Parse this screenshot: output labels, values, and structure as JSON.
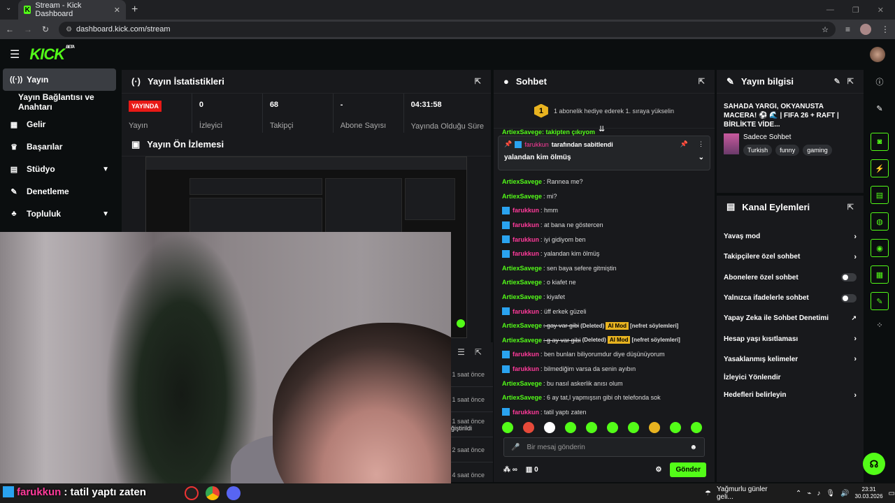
{
  "browser": {
    "tab_title": "Stream - Kick Dashboard",
    "tab_favicon": "K",
    "url": "dashboard.kick.com/stream"
  },
  "header": {
    "logo": "KICK",
    "beta": "BETA"
  },
  "sidebar": {
    "items": [
      {
        "label": "Yayın",
        "icon": "broadcast-icon"
      },
      {
        "label": "Yayın Bağlantısı ve Anahtarı"
      },
      {
        "label": "Gelir",
        "icon": "revenue-icon"
      },
      {
        "label": "Başarılar",
        "icon": "trophy-icon"
      },
      {
        "label": "Stüdyo",
        "icon": "studio-icon"
      },
      {
        "label": "Denetleme",
        "icon": "wrench-icon"
      },
      {
        "label": "Topluluk",
        "icon": "community-icon"
      }
    ]
  },
  "stats": {
    "title": "Yayın İstatistikleri",
    "live_badge": "YAYINDA",
    "items": [
      {
        "value": "",
        "label": "Yayın"
      },
      {
        "value": "0",
        "label": "İzleyici"
      },
      {
        "value": "68",
        "label": "Takipçi"
      },
      {
        "value": "-",
        "label": "Abone Sayısı"
      },
      {
        "value": "04:31:58",
        "label": "Yayında Olduğu Süre"
      }
    ]
  },
  "preview": {
    "title": "Yayın Ön İzlemesi"
  },
  "history": {
    "times": [
      "1 saat önce",
      "1 saat önce",
      "1 saat önce",
      "2 saat önce",
      "4 saat önce"
    ],
    "changed": "ğiştirildi"
  },
  "overlay": {
    "name": "farukkun",
    "text": ": tatil yaptı zaten"
  },
  "chat": {
    "title": "Sohbet",
    "gift_badge": "1",
    "gift_text": "1 abonelik hediye ederek 1. sıraya yükselin",
    "partial_top": "ArtiexSavege: takipten çıkıyom",
    "pinned_by": "farukkun",
    "pinned_suffix": " tarafından sabitlendi",
    "pinned_msg": "yalandan kim ölmüş",
    "messages": [
      {
        "user": "ArtiexSavege",
        "color": "green",
        "text": ": Rannea me?"
      },
      {
        "user": "ArtiexSavege",
        "color": "green",
        "text": ": mi?"
      },
      {
        "user": "farukkun",
        "color": "pink",
        "text": ": hmm"
      },
      {
        "user": "farukkun",
        "color": "pink",
        "text": ": at bana ne göstercen"
      },
      {
        "user": "farukkun",
        "color": "pink",
        "text": ": iyi gidiyom ben"
      },
      {
        "user": "farukkun",
        "color": "pink",
        "text": ": yalandan kim ölmüş"
      },
      {
        "user": "ArtiexSavege",
        "color": "green",
        "text": ": sen baya sefere gitmiştin"
      },
      {
        "user": "ArtiexSavege",
        "color": "green",
        "text": ": o kiafet ne"
      },
      {
        "user": "ArtiexSavege",
        "color": "green",
        "text": ": kiyafet"
      },
      {
        "user": "farukkun",
        "color": "pink",
        "text": ": üff erkek güzeli"
      },
      {
        "user": "ArtiexSavege",
        "color": "green",
        "text": ": gay var gibi",
        "deleted": "(Deleted)",
        "tag": "AI Mod",
        "reason": "[nefret söylemleri]"
      },
      {
        "user": "ArtiexSavege",
        "color": "green",
        "text": ": g ay var gibi",
        "deleted": "(Deleted)",
        "tag": "AI Mod",
        "reason": "[nefret söylemleri]"
      },
      {
        "user": "farukkun",
        "color": "pink",
        "text": ": ben bunları biliyorumdur diye düşünüyorum"
      },
      {
        "user": "farukkun",
        "color": "pink",
        "text": ": bilmediğim varsa da senin ayıbın"
      },
      {
        "user": "ArtiexSavege",
        "color": "green",
        "text": ": bu nasıl askerlik anısı olum"
      },
      {
        "user": "ArtiexSavege",
        "color": "green",
        "text": ": 6 ay tat,l yapmışsın gibi oh telefonda sok"
      },
      {
        "user": "farukkun",
        "color": "pink",
        "text": ": tatil yaptı zaten"
      }
    ],
    "input_placeholder": "Bir mesaj gönderin",
    "points": "∞",
    "gift_count": "0",
    "send": "Gönder"
  },
  "info": {
    "title": "Yayın bilgisi",
    "stream_title": "SAHADA YARGI, OKYANUSTA MACERA! ⚽ 🌊 | FIFA 26 + RAFT | BİRLİKTE VİDE...",
    "category": "Sadece Sohbet",
    "tags": [
      "Turkish",
      "funny",
      "gaming"
    ]
  },
  "actions": {
    "title": "Kanal Eylemleri",
    "items": [
      {
        "label": "Yavaş mod",
        "kind": "chevron"
      },
      {
        "label": "Takipçilere özel sohbet",
        "kind": "chevron"
      },
      {
        "label": "Abonelere özel sohbet",
        "kind": "toggle"
      },
      {
        "label": "Yalnızca ifadelerle sohbet",
        "kind": "toggle"
      },
      {
        "label": "Yapay Zeka ile Sohbet Denetimi",
        "kind": "external"
      },
      {
        "label": "Hesap yaşı kısıtlaması",
        "kind": "chevron"
      },
      {
        "label": "Yasaklanmış kelimeler",
        "kind": "chevron"
      },
      {
        "label": "İzleyici Yönlendir",
        "kind": "none"
      },
      {
        "label": "Hedefleri belirleyin",
        "kind": "chevron"
      }
    ]
  },
  "taskbar": {
    "weather": "Yağmurlu günler geli...",
    "time": "23:31",
    "date": "30.03.2026"
  },
  "colors": {
    "accent": "#53fc18",
    "live": "#e91916",
    "panel": "#18191c",
    "pink": "#ff3a9a"
  }
}
